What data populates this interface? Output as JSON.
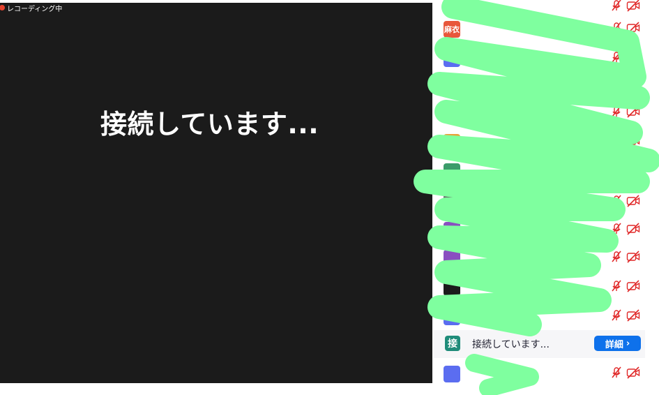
{
  "recording": {
    "label": "レコーディング中"
  },
  "video": {
    "status_text": "接続しています..."
  },
  "participants": [
    {
      "avatar_text": "",
      "avatar_color": "#e0e0e0",
      "name": ""
    },
    {
      "avatar_text": "麻衣",
      "avatar_color": "#e8573b",
      "name": ""
    },
    {
      "avatar_text": "",
      "avatar_color": "#5b6df0",
      "name": ""
    },
    {
      "avatar_text": "",
      "avatar_color": "#d94b8f",
      "name": ""
    },
    {
      "avatar_text": "",
      "avatar_color": "#7a5cc8",
      "name": ""
    },
    {
      "avatar_text": "",
      "avatar_color": "#e8a23b",
      "name": ""
    },
    {
      "avatar_text": "",
      "avatar_color": "#3b9c6a",
      "name": ""
    },
    {
      "avatar_text": "",
      "avatar_color": "#6a6a6a",
      "name": ""
    },
    {
      "avatar_text": "",
      "avatar_color": "#8a4fc0",
      "name": ""
    },
    {
      "avatar_text": "",
      "avatar_color": "#8a4fc0",
      "name": ""
    },
    {
      "avatar_text": "",
      "avatar_color": "#1b1b1b",
      "name": ""
    },
    {
      "avatar_text": "",
      "avatar_color": "#5b6df0",
      "name": ""
    }
  ],
  "connecting_row": {
    "avatar_text": "接",
    "status_text": "接続しています...",
    "detail_label": "詳細"
  },
  "bottom_participant": {
    "avatar_color": "#5b6df0",
    "name": ""
  },
  "icons": {
    "mic": "mic-muted-icon",
    "camera": "camera-off-icon",
    "detail": "chevron-right-icon"
  },
  "colors": {
    "muted_red": "#e02828",
    "accent_blue": "#0e71eb",
    "scribble": "#7fff9f"
  }
}
